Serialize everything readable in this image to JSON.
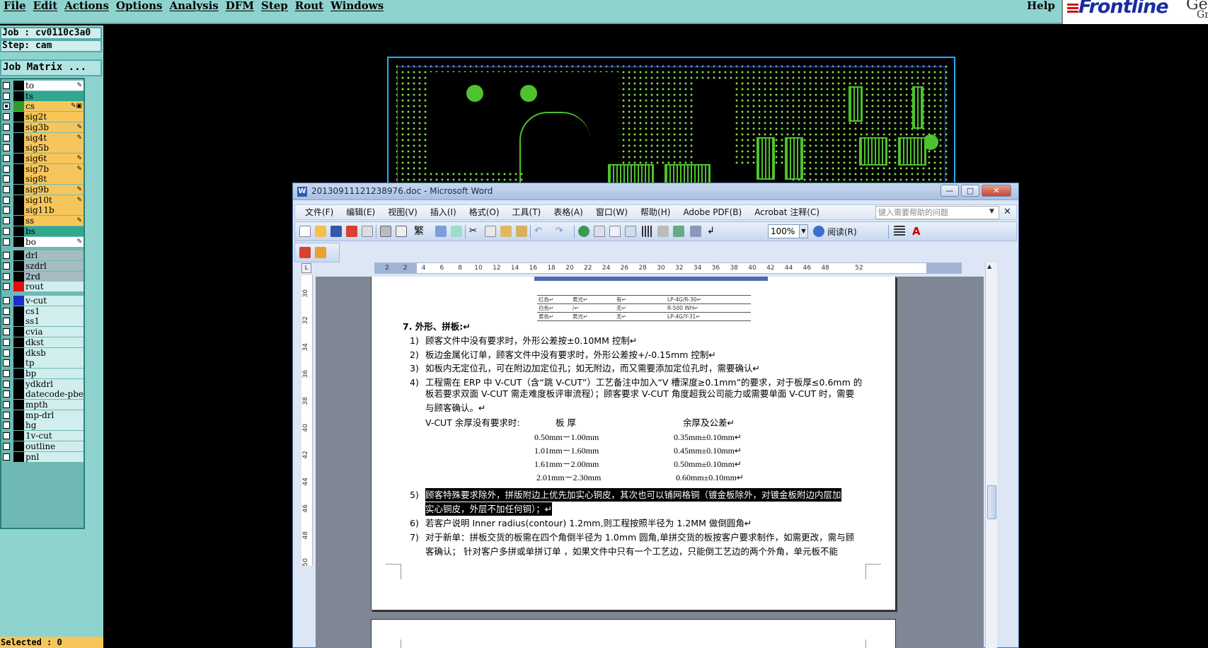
{
  "genesis": {
    "menu": [
      "File",
      "Edit",
      "Actions",
      "Options",
      "Analysis",
      "DFM",
      "Step",
      "Rout",
      "Windows"
    ],
    "help": "Help",
    "logo": {
      "brand": "Frontline",
      "ge": "Ge",
      "gr": "Gr"
    },
    "job": "Job : cv0110c3a0",
    "step": "Step: cam",
    "job_matrix": "Job Matrix ...",
    "selected": "Selected : 0",
    "board_layers": [
      {
        "name": "to",
        "swatch": "#000000",
        "style": "white",
        "mark": "✎"
      },
      {
        "name": "ts",
        "swatch": "#000000",
        "style": "teal",
        "mark": ""
      },
      {
        "name": "cs",
        "swatch": "#2a9d2a",
        "style": "board",
        "mark": "✎▣",
        "selected": true
      },
      {
        "name": "sig2t",
        "swatch": "#000000",
        "style": "board",
        "mark": ""
      },
      {
        "name": "sig3b",
        "swatch": "#000000",
        "style": "board",
        "mark": "✎"
      },
      {
        "name": "sig4t",
        "swatch": "#000000",
        "style": "board",
        "mark": "✎"
      },
      {
        "name": "sig5b",
        "swatch": "#000000",
        "style": "board",
        "mark": ""
      },
      {
        "name": "sig6t",
        "swatch": "#000000",
        "style": "board",
        "mark": "✎"
      },
      {
        "name": "sig7b",
        "swatch": "#000000",
        "style": "board",
        "mark": "✎"
      },
      {
        "name": "sig8t",
        "swatch": "#000000",
        "style": "board",
        "mark": ""
      },
      {
        "name": "sig9b",
        "swatch": "#000000",
        "style": "board",
        "mark": "✎"
      },
      {
        "name": "sig10t",
        "swatch": "#000000",
        "style": "board",
        "mark": "✎"
      },
      {
        "name": "sig11b",
        "swatch": "#000000",
        "style": "board",
        "mark": ""
      },
      {
        "name": "ss",
        "swatch": "#000000",
        "style": "board",
        "mark": "✎"
      },
      {
        "name": "bs",
        "swatch": "#000000",
        "style": "teal",
        "mark": ""
      },
      {
        "name": "bo",
        "swatch": "#000000",
        "style": "white",
        "mark": "✎"
      }
    ],
    "drill_layers": [
      {
        "name": "drl",
        "swatch": "#000000",
        "style": "grey"
      },
      {
        "name": "szdrl",
        "swatch": "#000000",
        "style": "grey"
      },
      {
        "name": "2rd",
        "swatch": "#000000",
        "style": "grey"
      },
      {
        "name": "rout",
        "swatch": "#e01010",
        "style": "light"
      }
    ],
    "misc_layers": [
      {
        "name": "v-cut",
        "swatch": "#1830d0"
      },
      {
        "name": "cs1",
        "swatch": "#000000"
      },
      {
        "name": "ss1",
        "swatch": "#000000"
      },
      {
        "name": "cvia",
        "swatch": "#000000"
      },
      {
        "name": "dkst",
        "swatch": "#000000"
      },
      {
        "name": "dksb",
        "swatch": "#000000"
      },
      {
        "name": "tp",
        "swatch": "#000000"
      },
      {
        "name": "bp",
        "swatch": "#000000"
      },
      {
        "name": "ydkdrl",
        "swatch": "#000000"
      },
      {
        "name": "datecode-pbe",
        "swatch": "#000000"
      },
      {
        "name": "mpth",
        "swatch": "#000000"
      },
      {
        "name": "mp-drl",
        "swatch": "#000000"
      },
      {
        "name": "hg",
        "swatch": "#000000"
      },
      {
        "name": "1v-cut",
        "swatch": "#000000"
      },
      {
        "name": "outline",
        "swatch": "#000000"
      },
      {
        "name": "pnl",
        "swatch": "#000000"
      }
    ]
  },
  "word": {
    "title": "20130911121238976.doc - Microsoft Word",
    "title_icon": "W",
    "menu": [
      "文件(F)",
      "编辑(E)",
      "视图(V)",
      "插入(I)",
      "格式(O)",
      "工具(T)",
      "表格(A)",
      "窗口(W)",
      "帮助(H)",
      "Adobe PDF(B)",
      "Acrobat 注释(C)"
    ],
    "help_placeholder": "键入需要帮助的问题",
    "zoom": "100%",
    "read_button": "阅读(R)",
    "ruler_h": [
      "2",
      "2",
      "4",
      "6",
      "8",
      "10",
      "12",
      "14",
      "16",
      "18",
      "20",
      "22",
      "24",
      "26",
      "28",
      "30",
      "32",
      "34",
      "36",
      "38",
      "40",
      "42",
      "44",
      "46",
      "48",
      "52"
    ],
    "ruler_v": [
      "30",
      "32",
      "34",
      "36",
      "38",
      "40",
      "42",
      "44",
      "46",
      "48",
      "50"
    ],
    "color_table": [
      [
        "红色↵",
        "黄光↵",
        "有↵",
        "LP-4G/R-30↵"
      ],
      [
        "白色↵",
        "/↵",
        "无↵",
        "R-500 WH↵"
      ],
      [
        "黄色↵",
        "黄光↵",
        "无↵",
        "LP-4G/Y-31↵"
      ]
    ],
    "doc": {
      "heading": "7.   外形、拼板:↵",
      "items": [
        {
          "num": "1)",
          "text": "顾客文件中没有要求时，外形公差按±0.10MM 控制↵"
        },
        {
          "num": "2)",
          "text": "板边金属化订单，顾客文件中没有要求时，外形公差按+/-0.15mm 控制↵"
        },
        {
          "num": "3)",
          "text": "如板内无定位孔，可在附边加定位孔；如无附边，而又需要添加定位孔时，需要确认↵"
        },
        {
          "num": "4)",
          "text": "工程需在 ERP 中 V-CUT（含“跳 V-CUT”）工艺备注中加入“V 槽深度≥0.1mm”的要求，对于板厚≤0.6mm 的"
        }
      ],
      "item4_line2": "板若要求双面 V-CUT 需走难度板评审流程）；顾客要求 V-CUT 角度超我公司能力或需要单面 V-CUT 时，需要",
      "item4_line3": "与顾客确认。↵",
      "vcut_label": "V-CUT 余厚没有要求时:",
      "col_thickness": "板   厚",
      "col_tolerance": "余厚及公差↵",
      "thickness_rows": [
        [
          "0.50mm－1.00mm",
          "0.35mm±0.10mm↵"
        ],
        [
          "1.01mm－1.60mm",
          "0.45mm±0.10mm↵"
        ],
        [
          "1.61mm－2.00mm",
          "0.50mm±0.10mm↵"
        ],
        [
          "2.01mm－2.30mm",
          "0.60mm±0.10mm↵"
        ]
      ],
      "item5_num": "5)",
      "item5_line1": "顾客特殊要求除外，拼版附边上优先加实心铜皮，其次也可以铺网格铜（镀金板除外，对镀金板附边内层加",
      "item5_line2": "实心铜皮，外层不加任何铜）；↵",
      "item6_num": "6)",
      "item6": "若客户说明 Inner radius(contour) 1.2mm,则工程按照半径为 1.2MM 做倒圆角↵",
      "item7_num": "7)",
      "item7_line1": "对于新单：拼板交货的板需在四个角倒半径为 1.0mm 圆角,单拼交货的板按客户要求制作，如需更改，需与顾",
      "item7_line2": "客确认；  针对客户多拼或单拼订单 ，如果文件中只有一个工艺边，只能倒工艺边的两个外角，单元板不能"
    }
  }
}
